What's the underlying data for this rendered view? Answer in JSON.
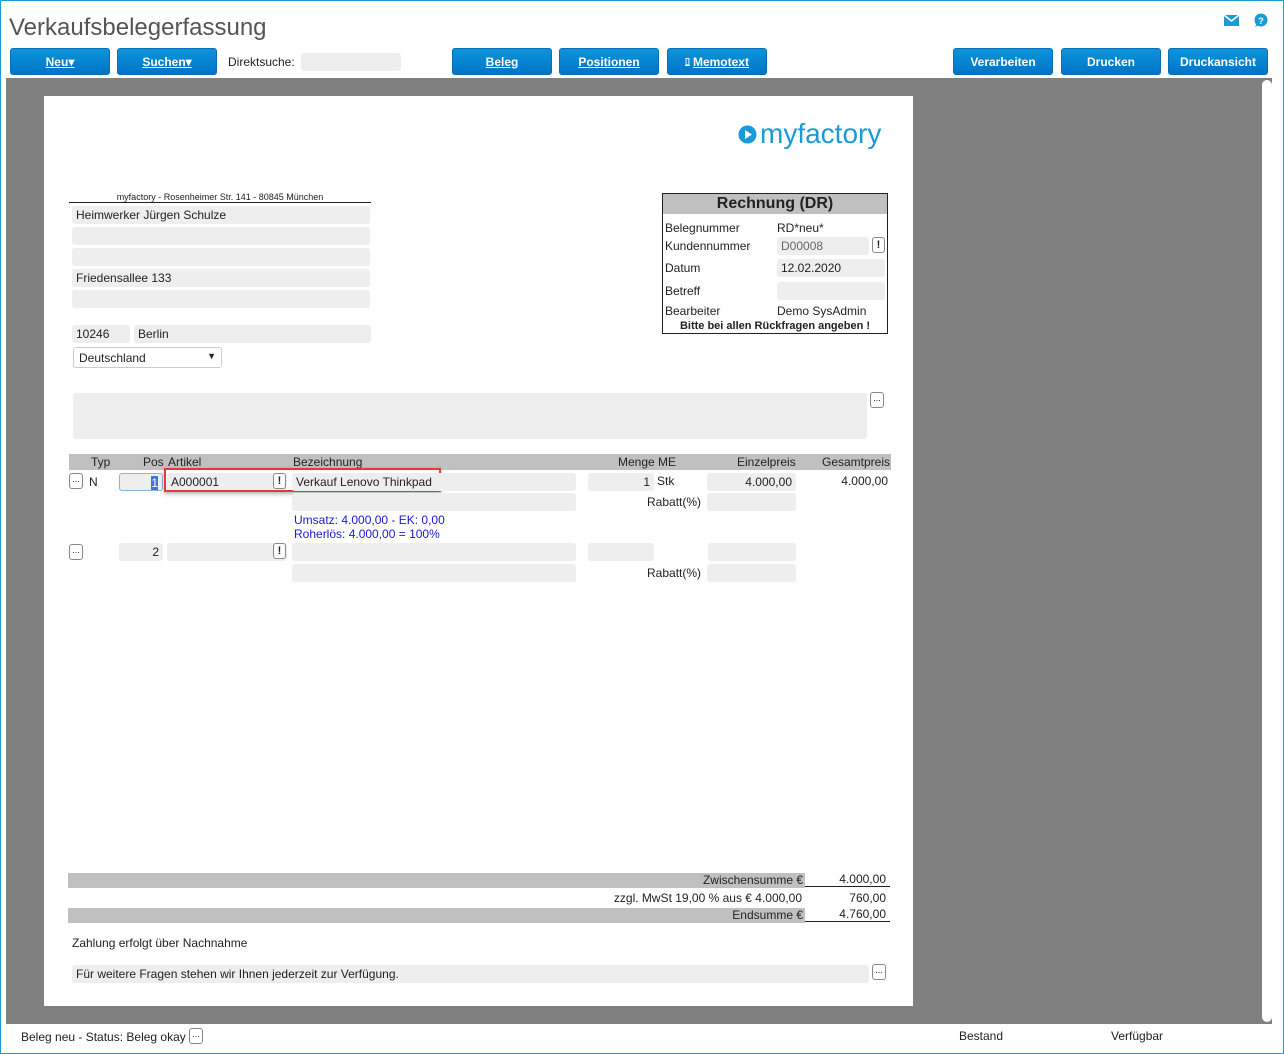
{
  "header": {
    "title": "Verkaufsbelegerfassung",
    "direct_search_label": "Direktsuche:",
    "direct_search_value": ""
  },
  "toolbar": {
    "new": "Neu",
    "search": "Suchen",
    "beleg": "Beleg",
    "positionen": "Positionen",
    "memotext": "Memotext",
    "verarbeiten": "Verarbeiten",
    "drucken": "Drucken",
    "druckansicht": "Druckansicht"
  },
  "logo": "myfactory",
  "address": {
    "sender": "myfactory - Rosenheimer Str. 141 - 80845 München",
    "name": "Heimwerker Jürgen Schulze",
    "line2": "",
    "line3": "",
    "street": "Friedensallee 133",
    "line5": "",
    "zip": "10246",
    "city": "Berlin",
    "country": "Deutschland"
  },
  "doc": {
    "title": "Rechnung (DR)",
    "belegnummer_label": "Belegnummer",
    "belegnummer": "RD*neu*",
    "kunde_label": "Kundennummer",
    "kunde": "D00008",
    "datum_label": "Datum",
    "datum": "12.02.2020",
    "betreff_label": "Betreff",
    "betreff": "",
    "bearbeiter_label": "Bearbeiter",
    "bearbeiter": "Demo SysAdmin",
    "note": "Bitte bei allen Rückfragen angeben !"
  },
  "columns": {
    "typ": "Typ",
    "pos": "Pos",
    "artikel": "Artikel",
    "bez": "Bezeichnung",
    "menge": "Menge",
    "me": "ME",
    "einzel": "Einzelpreis",
    "gesamt": "Gesamtpreis"
  },
  "positions": [
    {
      "typ": "N",
      "pos": "1",
      "artikel": "A000001",
      "bez": "Verkauf Lenovo Thinkpad",
      "menge": "1",
      "me": "Stk",
      "einzel": "4.000,00",
      "gesamt": "4.000,00",
      "rabatt_label": "Rabatt(%)",
      "umsatz": "Umsatz: 4.000,00 - EK: 0,00",
      "roherloes": "Roherlös: 4.000,00 = 100%"
    },
    {
      "typ": "",
      "pos": "2",
      "artikel": "",
      "bez": "",
      "menge": "",
      "me": "",
      "einzel": "",
      "gesamt": "",
      "rabatt_label": "Rabatt(%)"
    }
  ],
  "totals": {
    "zwischen_label": "Zwischensumme €",
    "zwischen": "4.000,00",
    "mwst_label": "zzgl. MwSt 19,00 % aus € 4.000,00",
    "mwst": "760,00",
    "end_label": "Endsumme €",
    "end": "4.760,00"
  },
  "footer": {
    "payment": "Zahlung erfolgt über Nachnahme",
    "closing": "Für weitere Fragen stehen wir Ihnen jederzeit zur Verfügung."
  },
  "status": {
    "text": "Beleg neu - Status: Beleg okay",
    "bestand": "Bestand",
    "verfuegbar": "Verfügbar"
  },
  "colors": {
    "accent": "#0a86d0",
    "highlight": "#e53935",
    "link": "#1a1ad6"
  }
}
